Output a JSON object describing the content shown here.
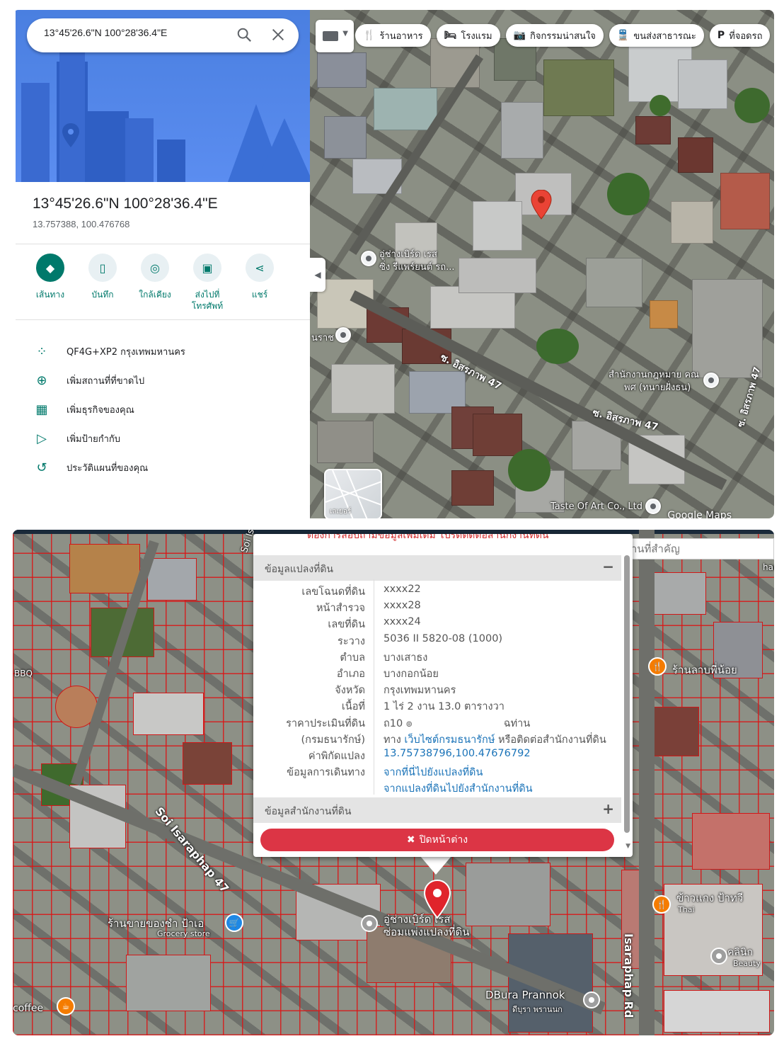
{
  "gmaps": {
    "search": {
      "value": "13°45'26.6\"N 100°28'36.4\"E"
    },
    "place": {
      "title": "13°45'26.6\"N 100°28'36.4\"E",
      "coords": "13.757388, 100.476768"
    },
    "actions": [
      {
        "label": "เส้นทาง",
        "icon": "directions-icon"
      },
      {
        "label": "บันทึก",
        "icon": "bookmark-icon"
      },
      {
        "label": "ใกล้เคียง",
        "icon": "nearby-icon"
      },
      {
        "label": "ส่งไปที่\nโทรศัพท์",
        "icon": "send-to-phone-icon"
      },
      {
        "label": "แชร์",
        "icon": "share-icon"
      }
    ],
    "list": [
      {
        "label": "QF4G+XP2 กรุงเทพมหานคร",
        "icon": "plus-code-icon"
      },
      {
        "label": "เพิ่มสถานที่ที่ขาดไป",
        "icon": "add-place-icon"
      },
      {
        "label": "เพิ่มธุรกิจของคุณ",
        "icon": "add-business-icon"
      },
      {
        "label": "เพิ่มป้ายกำกับ",
        "icon": "label-icon"
      },
      {
        "label": "ประวัติแผนที่ของคุณ",
        "icon": "history-icon"
      }
    ],
    "chips": [
      {
        "label": "ร้านอาหาร",
        "icon": "restaurant-icon",
        "glyph": "🍴"
      },
      {
        "label": "โรงแรม",
        "icon": "hotel-icon",
        "glyph": "🛏"
      },
      {
        "label": "กิจกรรมน่าสนใจ",
        "icon": "camera-icon",
        "glyph": "📷"
      },
      {
        "label": "ขนส่งสาธารณะ",
        "icon": "transit-icon",
        "glyph": "🚆"
      },
      {
        "label": "ที่จอดรถ",
        "icon": "parking-icon",
        "glyph": "P"
      }
    ],
    "map_labels": {
      "poi1_line1": "อู่ช่างเบิร์ด เรส",
      "poi1_line2": "ซิ่ง รีแพร์ยนต์ รถ...",
      "poi2": "นราช",
      "street1": "ซ. อิสรภาพ 47",
      "street2": "ซ. อิสรภาพ 47",
      "street3": "ซ. อิสรภาพ 47",
      "office_line1": "สำนักงานกฎหมาย คณ",
      "office_line2": "พศ (ทนายฝั่งธน)",
      "shop": "Taste Of Art Co., Ltd",
      "attribution": "Google Maps"
    },
    "layers_label": "เลเยอร์"
  },
  "landmap": {
    "warning": "ต้องการสอบถามข้อมูลเพิ่มเติม โปรดติดต่อสำนักงานที่ดิน",
    "landmark_search_placeholder": "ค้นหาสถานที่สำคัญ",
    "section1": {
      "title": "ข้อมูลแปลงที่ดิน",
      "toggle": "−"
    },
    "rows": [
      {
        "key": "เลขโฉนดที่ดิน",
        "value": "xxxx22"
      },
      {
        "key": "หน้าสำรวจ",
        "value": "xxxx28"
      },
      {
        "key": "เลขที่ดิน",
        "value": "xxxx24"
      },
      {
        "key": "ระวาง",
        "value": "5036 II 5820-08 (1000)"
      },
      {
        "key": "ตำบล",
        "value": "บางเสาธง"
      },
      {
        "key": "อำเภอ",
        "value": "บางกอกน้อย"
      },
      {
        "key": "จังหวัด",
        "value": "กรุงเทพมหานคร"
      },
      {
        "key": "เนื้อที่",
        "value": "1 ไร่ 2 งาน 13.0 ตารางวา"
      },
      {
        "key": "ราคาประเมินที่ดิน",
        "value": "ถ10 ๏                            ฉท่าน"
      },
      {
        "key": "(กรมธนารักษ์)",
        "value_pre": "ทาง ",
        "value_link": "เว็บไซต์กรมธนารักษ์",
        "value_post": " หรือติดต่อสำนักงานที่ดิน"
      },
      {
        "key": "ค่าพิกัดแปลง",
        "value": "13.75738796,100.47676792",
        "link": true
      },
      {
        "key": "ข้อมูลการเดินทาง",
        "value": "จากที่นี่ไปยังแปลงที่ดิน",
        "link": true
      },
      {
        "key": "",
        "value": "จากแปลงที่ดินไปยังสำนักงานที่ดิน",
        "link": true
      }
    ],
    "section2": {
      "title": "ข้อมูลสำนักงานที่ดิน",
      "toggle": "+"
    },
    "close_button": "ปิดหน้าต่าง",
    "map_labels": {
      "road_main": "Isaraphap Rd",
      "soi": "Soi Isaraphap 47",
      "shop1": "ร้านขายของชำ ป้าเอ",
      "shop1_sub": "Grocery store",
      "rest1": "ร้านลาบพี่น้อย",
      "rest2": "ข้าวแกง ป้าทวี",
      "rest2_sub": "Thai",
      "clinic": "คลินิก",
      "clinic_sub": "Beauty",
      "dbura": "DBura Prannok",
      "dbura_sub": "ดีบุรา พรานนก",
      "garage1": "อู่ช่างเบิร์ด เรส",
      "garage2": "ซ่อมแพ่งแปลงที่ดิน",
      "coffee": "coffee",
      "bbq": "BBQ",
      "hand": "hand",
      "soi_short": "Soi Is"
    },
    "colors": {
      "parcel_line": "#d01818",
      "close_button": "#dc3545",
      "link": "#1a73b8"
    }
  }
}
